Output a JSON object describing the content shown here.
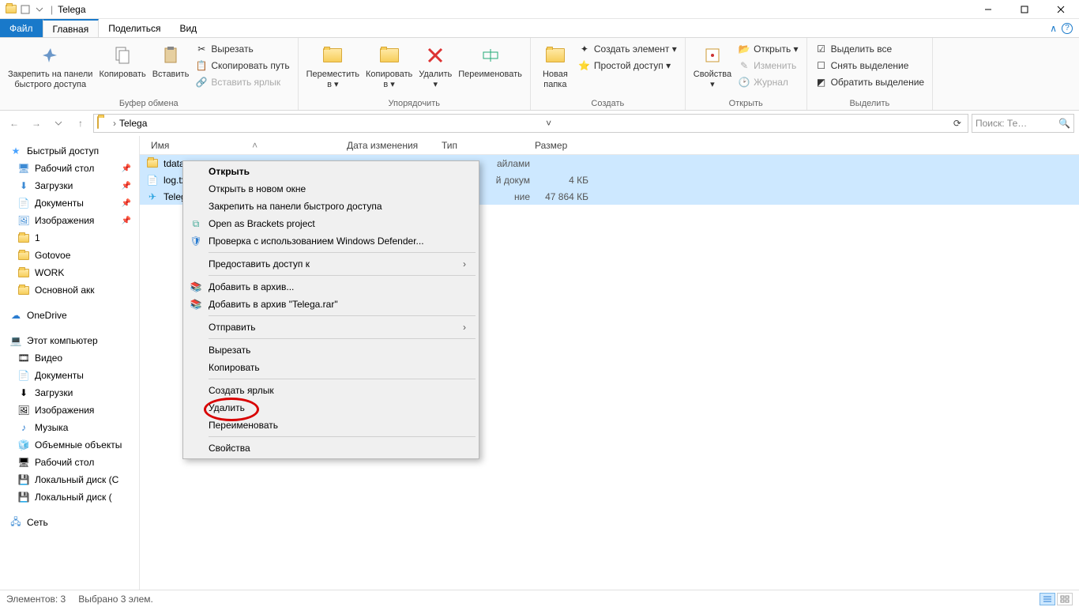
{
  "title": "Telega",
  "qat_sep": "|",
  "tabs": {
    "file": "Файл",
    "home": "Главная",
    "share": "Поделиться",
    "view": "Вид"
  },
  "ribbon": {
    "clipboard": {
      "label": "Буфер обмена",
      "pin": "Закрепить на панели\nбыстрого доступа",
      "copy": "Копировать",
      "paste": "Вставить",
      "cut": "Вырезать",
      "copypath": "Скопировать путь",
      "pastelink": "Вставить ярлык"
    },
    "organize": {
      "label": "Упорядочить",
      "moveto": "Переместить\nв ▾",
      "copyto": "Копировать\nв ▾",
      "delete": "Удалить\n▾",
      "rename": "Переименовать"
    },
    "new": {
      "label": "Создать",
      "newfolder": "Новая\nпапка",
      "newitem": "Создать элемент ▾",
      "easyaccess": "Простой доступ ▾"
    },
    "open": {
      "label": "Открыть",
      "props": "Свойства\n▾",
      "open": "Открыть ▾",
      "edit": "Изменить",
      "history": "Журнал"
    },
    "select": {
      "label": "Выделить",
      "all": "Выделить все",
      "none": "Снять выделение",
      "invert": "Обратить выделение"
    }
  },
  "breadcrumb": {
    "root": "",
    "folder": "Telega"
  },
  "search_placeholder": "Поиск: Те…",
  "columns": {
    "name": "Имя",
    "date": "Дата изменения",
    "type": "Тип",
    "size": "Размер"
  },
  "files": [
    {
      "name": "tdata",
      "type_partial": "айлами",
      "size": ""
    },
    {
      "name": "log.tx",
      "type_partial": "й докум",
      "size": "4 КБ"
    },
    {
      "name": "Teleg",
      "type_partial": "ние",
      "size": "47 864 КБ"
    }
  ],
  "nav": {
    "quick": "Быстрый доступ",
    "desktop": "Рабочий стол",
    "downloads": "Загрузки",
    "documents": "Документы",
    "pictures": "Изображения",
    "f1": "1",
    "f2": "Gotovoe",
    "f3": "WORK",
    "f4": "Основной акк",
    "onedrive": "OneDrive",
    "thispc": "Этот компьютер",
    "videos": "Видео",
    "documents2": "Документы",
    "downloads2": "Загрузки",
    "pictures2": "Изображения",
    "music": "Музыка",
    "objects3d": "Объемные объекты",
    "desktop2": "Рабочий стол",
    "drive_c": "Локальный диск (C",
    "drive_d": "Локальный диск (",
    "network": "Сеть"
  },
  "ctx": {
    "open": "Открыть",
    "open_new": "Открыть в новом окне",
    "pin_quick": "Закрепить на панели быстрого доступа",
    "brackets": "Open as Brackets project",
    "defender": "Проверка с использованием Windows Defender...",
    "grant": "Предоставить доступ к",
    "add_archive": "Добавить в архив...",
    "add_rar": "Добавить в архив \"Telega.rar\"",
    "send": "Отправить",
    "cut": "Вырезать",
    "copy": "Копировать",
    "shortcut": "Создать ярлык",
    "delete": "Удалить",
    "rename": "Переименовать",
    "props": "Свойства"
  },
  "status": {
    "count": "Элементов: 3",
    "selected": "Выбрано 3 элем."
  }
}
